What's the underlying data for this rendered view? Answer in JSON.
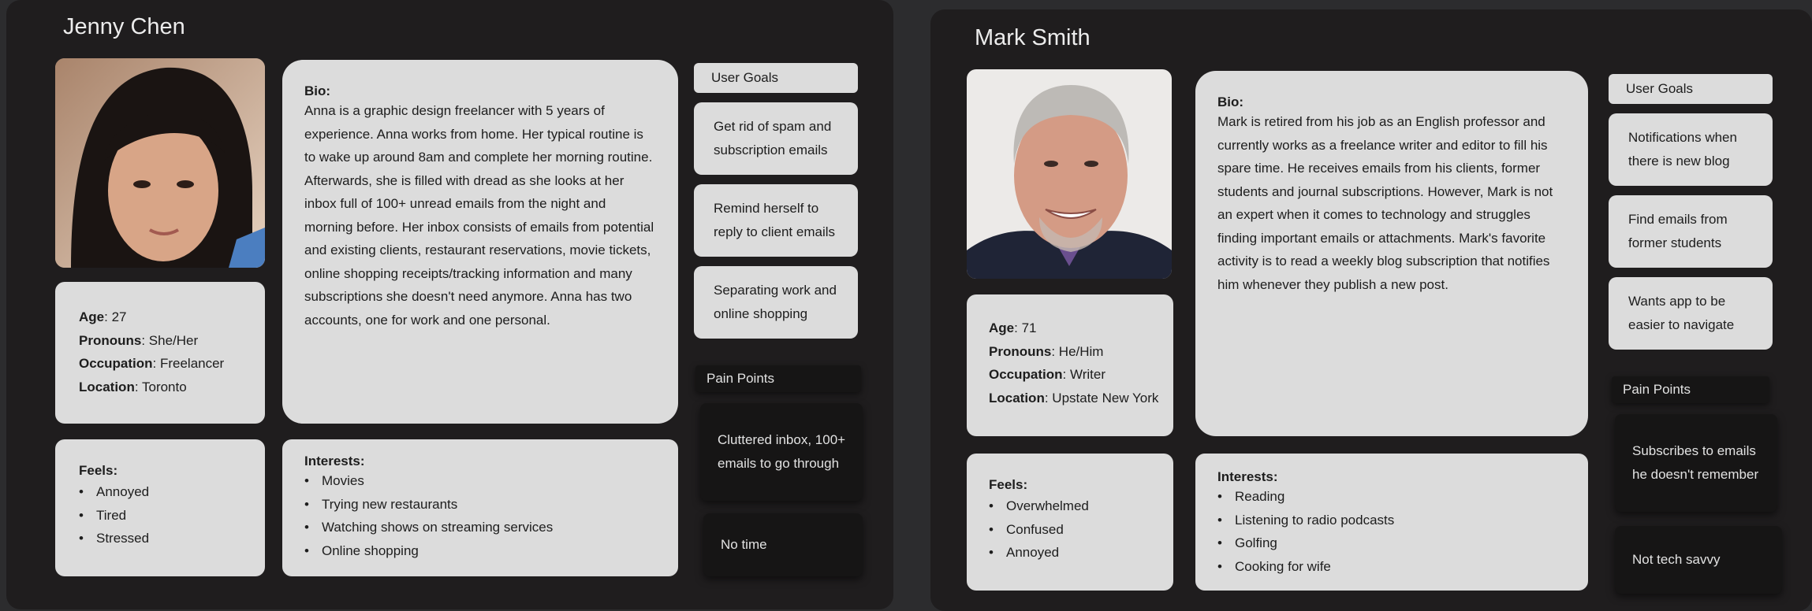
{
  "personas": [
    {
      "name": "Jenny Chen",
      "bio_heading": "Bio:",
      "bio": "Anna is a graphic design freelancer with 5 years of experience. Anna works from home. Her typical routine is to wake up around 8am and complete her morning routine. Afterwards, she is filled with dread as she looks at her inbox full of 100+ unread emails from the night and morning before. Her inbox consists of emails from potential and existing clients, restaurant reservations, movie tickets, online shopping receipts/tracking information and many subscriptions she doesn't need anymore. Anna has two accounts, one for work and one personal.",
      "info": [
        {
          "label": "Age",
          "value": ": 27"
        },
        {
          "label": "Pronouns",
          "value": ": She/Her"
        },
        {
          "label": "Occupation",
          "value": ": Freelancer"
        },
        {
          "label": "Location",
          "value": ": Toronto"
        }
      ],
      "feels_heading": "Feels:",
      "feels": [
        "Annoyed",
        "Tired",
        "Stressed"
      ],
      "interests_heading": "Interests:",
      "interests": [
        "Movies",
        "Trying new restaurants",
        "Watching shows on streaming services",
        "Online shopping"
      ],
      "goals_heading": "User Goals",
      "goals": [
        "Get rid of spam and subscription emails",
        "Remind herself to reply to client emails",
        "Separating work and online shopping"
      ],
      "pain_heading": "Pain Points",
      "pain_points": [
        "Cluttered inbox, 100+ emails to go through",
        "No time"
      ],
      "photo_colors": {
        "bg": "#c9a98c",
        "hair": "#1a1412",
        "skin": "#d9a88a"
      }
    },
    {
      "name": "Mark Smith",
      "bio_heading": "Bio:",
      "bio": "Mark is retired from his job as an English professor and currently works as a freelance writer and editor to fill his spare time. He receives emails from his clients, former students and journal subscriptions. However, Mark is not an expert when it comes to technology and struggles finding important emails or attachments. Mark's favorite activity is to read a weekly blog subscription that notifies him whenever they publish a new post.",
      "info": [
        {
          "label": "Age",
          "value": ": 71"
        },
        {
          "label": "Pronouns",
          "value": ": He/Him"
        },
        {
          "label": "Occupation",
          "value": ": Writer"
        },
        {
          "label": "Location",
          "value": ": Upstate New York"
        }
      ],
      "feels_heading": "Feels:",
      "feels": [
        "Overwhelmed",
        "Confused",
        "Annoyed"
      ],
      "interests_heading": "Interests:",
      "interests": [
        "Reading",
        "Listening to radio podcasts",
        "Golfing",
        "Cooking for wife"
      ],
      "goals_heading": "User Goals",
      "goals": [
        "Notifications when there is new blog",
        "Find emails from former students",
        "Wants app to be easier to navigate"
      ],
      "pain_heading": "Pain Points",
      "pain_points": [
        "Subscribes to emails he doesn't remember",
        "Not tech savvy"
      ],
      "photo_colors": {
        "bg": "#eceae8",
        "hair": "#bdbab6",
        "skin": "#d79c86"
      }
    }
  ]
}
